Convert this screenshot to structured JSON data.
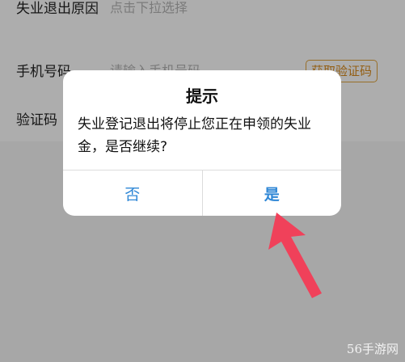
{
  "form": {
    "reason": {
      "label": "失业退出原因",
      "value": "点击下拉选择"
    },
    "phone": {
      "label": "手机号码",
      "placeholder": "请输入手机号码",
      "code_button": "获取验证码"
    },
    "code": {
      "label": "验证码"
    }
  },
  "dialog": {
    "title": "提示",
    "message": "失业登记退出将停止您正在申领的失业金，是否继续?",
    "no_label": "否",
    "yes_label": "是"
  },
  "colors": {
    "accent": "#2f87d6",
    "code_button": "#d98b1d",
    "arrow": "#f0415a"
  },
  "watermark": "56手游网"
}
